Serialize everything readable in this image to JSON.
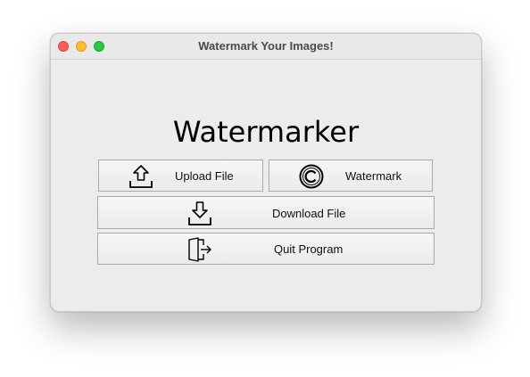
{
  "window": {
    "title": "Watermark Your Images!"
  },
  "main": {
    "heading": "Watermarker",
    "buttons": {
      "upload": {
        "label": "Upload File",
        "icon": "upload-icon"
      },
      "watermark": {
        "label": "Watermark",
        "icon": "copyright-icon"
      },
      "download": {
        "label": "Download File",
        "icon": "download-icon"
      },
      "quit": {
        "label": "Quit Program",
        "icon": "exit-door-icon"
      }
    }
  },
  "colors": {
    "close": "#fe5f57",
    "minimize": "#febc2e",
    "maximize": "#28c840",
    "window_bg": "#ececec"
  }
}
